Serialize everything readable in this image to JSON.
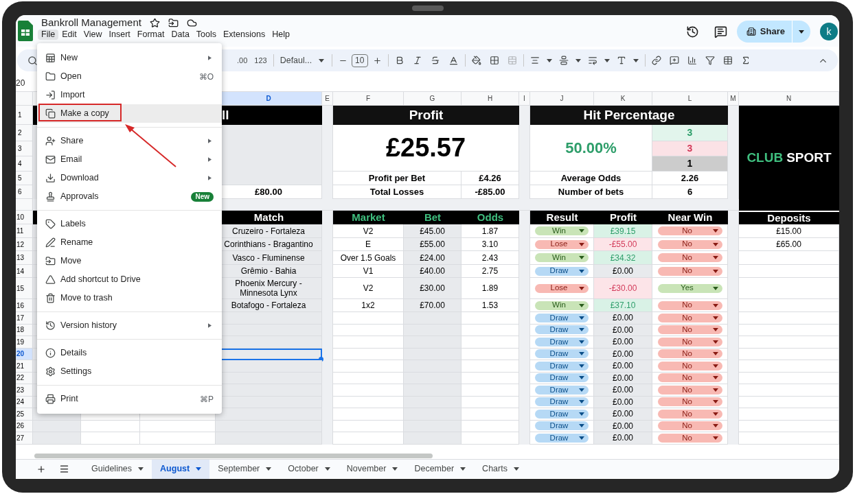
{
  "doc": {
    "title": "Bankroll Management"
  },
  "menubar": [
    {
      "label": "File",
      "selected": true
    },
    {
      "label": "Edit",
      "selected": false
    },
    {
      "label": "View",
      "selected": false
    },
    {
      "label": "Insert",
      "selected": false
    },
    {
      "label": "Format",
      "selected": false
    },
    {
      "label": "Data",
      "selected": false
    },
    {
      "label": "Tools",
      "selected": false
    },
    {
      "label": "Extensions",
      "selected": false
    },
    {
      "label": "Help",
      "selected": false
    }
  ],
  "share_button": "Share",
  "avatar": "k",
  "toolbar": {
    "decimals": ".00",
    "number_format": "123",
    "font": "Defaul...",
    "font_size": "10"
  },
  "name_box": "20",
  "file_menu": [
    [
      {
        "label": "New",
        "submenu": true,
        "highlighted": false
      },
      {
        "label": "Open",
        "shortcut": "⌘O",
        "submenu": false,
        "highlighted": false
      },
      {
        "label": "Import",
        "submenu": false,
        "highlighted": false
      },
      {
        "label": "Make a copy",
        "submenu": false,
        "highlighted": true
      }
    ],
    [
      {
        "label": "Share",
        "submenu": true,
        "highlighted": false
      },
      {
        "label": "Email",
        "submenu": true,
        "highlighted": false
      },
      {
        "label": "Download",
        "submenu": true,
        "highlighted": false
      },
      {
        "label": "Approvals",
        "badge": "New",
        "submenu": false,
        "highlighted": false
      }
    ],
    [
      {
        "label": "Labels",
        "submenu": false,
        "highlighted": false
      },
      {
        "label": "Rename",
        "submenu": false,
        "highlighted": false
      },
      {
        "label": "Move",
        "submenu": false,
        "highlighted": false
      },
      {
        "label": "Add shortcut to Drive",
        "submenu": false,
        "highlighted": false
      },
      {
        "label": "Move to trash",
        "submenu": false,
        "highlighted": false
      }
    ],
    [
      {
        "label": "Version history",
        "submenu": true,
        "highlighted": false
      }
    ],
    [
      {
        "label": "Details",
        "submenu": false,
        "highlighted": false
      },
      {
        "label": "Settings",
        "submenu": false,
        "highlighted": false
      }
    ],
    [
      {
        "label": "Print",
        "shortcut": "⌘P",
        "submenu": false,
        "highlighted": false
      }
    ]
  ],
  "columns": [
    {
      "label": "D",
      "selected": true
    },
    {
      "label": "E",
      "selected": false
    },
    {
      "label": "F",
      "selected": false
    },
    {
      "label": "G",
      "selected": false
    },
    {
      "label": "H",
      "selected": false
    },
    {
      "label": "I",
      "selected": false
    },
    {
      "label": "J",
      "selected": false
    },
    {
      "label": "K",
      "selected": false
    },
    {
      "label": "L",
      "selected": false
    },
    {
      "label": "M",
      "selected": false
    },
    {
      "label": "N",
      "selected": false
    }
  ],
  "rows": [
    {
      "label": "1",
      "selected": false
    },
    {
      "label": "2",
      "selected": false
    },
    {
      "label": "3",
      "selected": false
    },
    {
      "label": "4",
      "selected": false
    },
    {
      "label": "5",
      "selected": false
    },
    {
      "label": "6",
      "selected": false
    },
    {
      "label": "10",
      "selected": false
    },
    {
      "label": "11",
      "selected": false
    },
    {
      "label": "12",
      "selected": false
    },
    {
      "label": "13",
      "selected": false
    },
    {
      "label": "14",
      "selected": false
    },
    {
      "label": "15",
      "selected": false
    },
    {
      "label": "16",
      "selected": false
    },
    {
      "label": "17",
      "selected": false
    },
    {
      "label": "18",
      "selected": false
    },
    {
      "label": "19",
      "selected": false
    },
    {
      "label": "20",
      "selected": true
    },
    {
      "label": "21",
      "selected": false
    },
    {
      "label": "22",
      "selected": false
    },
    {
      "label": "23",
      "selected": false
    },
    {
      "label": "24",
      "selected": false
    },
    {
      "label": "25",
      "selected": false
    },
    {
      "label": "26",
      "selected": false
    },
    {
      "label": "27",
      "selected": false
    }
  ],
  "bankroll": {
    "title_visible": "ll",
    "total": "£80.00"
  },
  "profit": {
    "title": "Profit",
    "amount": "£25.57",
    "stats": [
      {
        "label": "Profit per Bet",
        "value": "£4.26"
      },
      {
        "label": "Total Losses",
        "value": "-£85.00"
      }
    ]
  },
  "hit_percentage": {
    "title": "Hit Percentage",
    "rate": "50.00%",
    "counts": [
      {
        "value": "3",
        "kind": "win"
      },
      {
        "value": "3",
        "kind": "lose"
      },
      {
        "value": "1",
        "kind": "draw"
      }
    ],
    "stats": [
      {
        "label": "Average Odds",
        "value": "2.26"
      },
      {
        "label": "Number of bets",
        "value": "6"
      }
    ]
  },
  "logo": {
    "accent": "CLUB",
    "text": "SPORT"
  },
  "bets": {
    "columns": [
      "Match",
      "Market",
      "Bet",
      "Odds",
      "Result",
      "Profit",
      "Near Win"
    ],
    "rows": [
      {
        "match": "Cruzeiro - Fortaleza",
        "market": "V2",
        "bet": "£45.00",
        "odds": "1.87",
        "result": {
          "label": "Win",
          "kind": "win"
        },
        "profit": "£39.15",
        "near_win": {
          "label": "No",
          "kind": "no"
        }
      },
      {
        "match": "Corinthians - Bragantino",
        "market": "E",
        "bet": "£55.00",
        "odds": "3.10",
        "result": {
          "label": "Lose",
          "kind": "lose"
        },
        "profit": "-£55.00",
        "near_win": {
          "label": "No",
          "kind": "no"
        }
      },
      {
        "match": "Vasco - Fluminense",
        "market": "Over 1.5 Goals",
        "bet": "£24.00",
        "odds": "2.43",
        "result": {
          "label": "Win",
          "kind": "win"
        },
        "profit": "£34.32",
        "near_win": {
          "label": "No",
          "kind": "no"
        }
      },
      {
        "match": "Grêmio - Bahia",
        "market": "V1",
        "bet": "£40.00",
        "odds": "2.75",
        "result": {
          "label": "Draw",
          "kind": "draw"
        },
        "profit": "£0.00",
        "near_win": {
          "label": "No",
          "kind": "no"
        }
      },
      {
        "match": "Phoenix Mercury - Minnesota Lynx",
        "market": "V2",
        "bet": "£30.00",
        "odds": "1.89",
        "result": {
          "label": "Lose",
          "kind": "lose"
        },
        "profit": "-£30.00",
        "near_win": {
          "label": "Yes",
          "kind": "yes"
        }
      },
      {
        "match": "Botafogo - Fortaleza",
        "market": "1x2",
        "bet": "£70.00",
        "odds": "1.53",
        "result": {
          "label": "Win",
          "kind": "win"
        },
        "profit": "£37.10",
        "near_win": {
          "label": "No",
          "kind": "no"
        }
      },
      {
        "result": {
          "label": "Draw",
          "kind": "draw"
        },
        "profit": "£0.00",
        "near_win": {
          "label": "No",
          "kind": "no"
        }
      },
      {
        "result": {
          "label": "Draw",
          "kind": "draw"
        },
        "profit": "£0.00",
        "near_win": {
          "label": "No",
          "kind": "no"
        }
      },
      {
        "result": {
          "label": "Draw",
          "kind": "draw"
        },
        "profit": "£0.00",
        "near_win": {
          "label": "No",
          "kind": "no"
        }
      },
      {
        "result": {
          "label": "Draw",
          "kind": "draw"
        },
        "profit": "£0.00",
        "near_win": {
          "label": "No",
          "kind": "no"
        }
      },
      {
        "result": {
          "label": "Draw",
          "kind": "draw"
        },
        "profit": "£0.00",
        "near_win": {
          "label": "No",
          "kind": "no"
        }
      },
      {
        "result": {
          "label": "Draw",
          "kind": "draw"
        },
        "profit": "£0.00",
        "near_win": {
          "label": "No",
          "kind": "no"
        }
      },
      {
        "result": {
          "label": "Draw",
          "kind": "draw"
        },
        "profit": "£0.00",
        "near_win": {
          "label": "No",
          "kind": "no"
        }
      },
      {
        "result": {
          "label": "Draw",
          "kind": "draw"
        },
        "profit": "£0.00",
        "near_win": {
          "label": "No",
          "kind": "no"
        }
      },
      {
        "result": {
          "label": "Draw",
          "kind": "draw"
        },
        "profit": "£0.00",
        "near_win": {
          "label": "No",
          "kind": "no"
        }
      },
      {
        "result": {
          "label": "Draw",
          "kind": "draw"
        },
        "profit": "£0.00",
        "near_win": {
          "label": "No",
          "kind": "no"
        }
      },
      {
        "result": {
          "label": "Draw",
          "kind": "draw"
        },
        "profit": "£0.00",
        "near_win": {
          "label": "No",
          "kind": "no"
        }
      }
    ]
  },
  "deposits": {
    "title": "Deposits",
    "values": [
      "£15.00",
      "£65.00"
    ]
  },
  "sheet_tabs": [
    {
      "label": "Guidelines",
      "selected": false
    },
    {
      "label": "August",
      "selected": true
    },
    {
      "label": "September",
      "selected": false
    },
    {
      "label": "October",
      "selected": false
    },
    {
      "label": "November",
      "selected": false
    },
    {
      "label": "December",
      "selected": false
    },
    {
      "label": "Charts",
      "selected": false
    }
  ]
}
